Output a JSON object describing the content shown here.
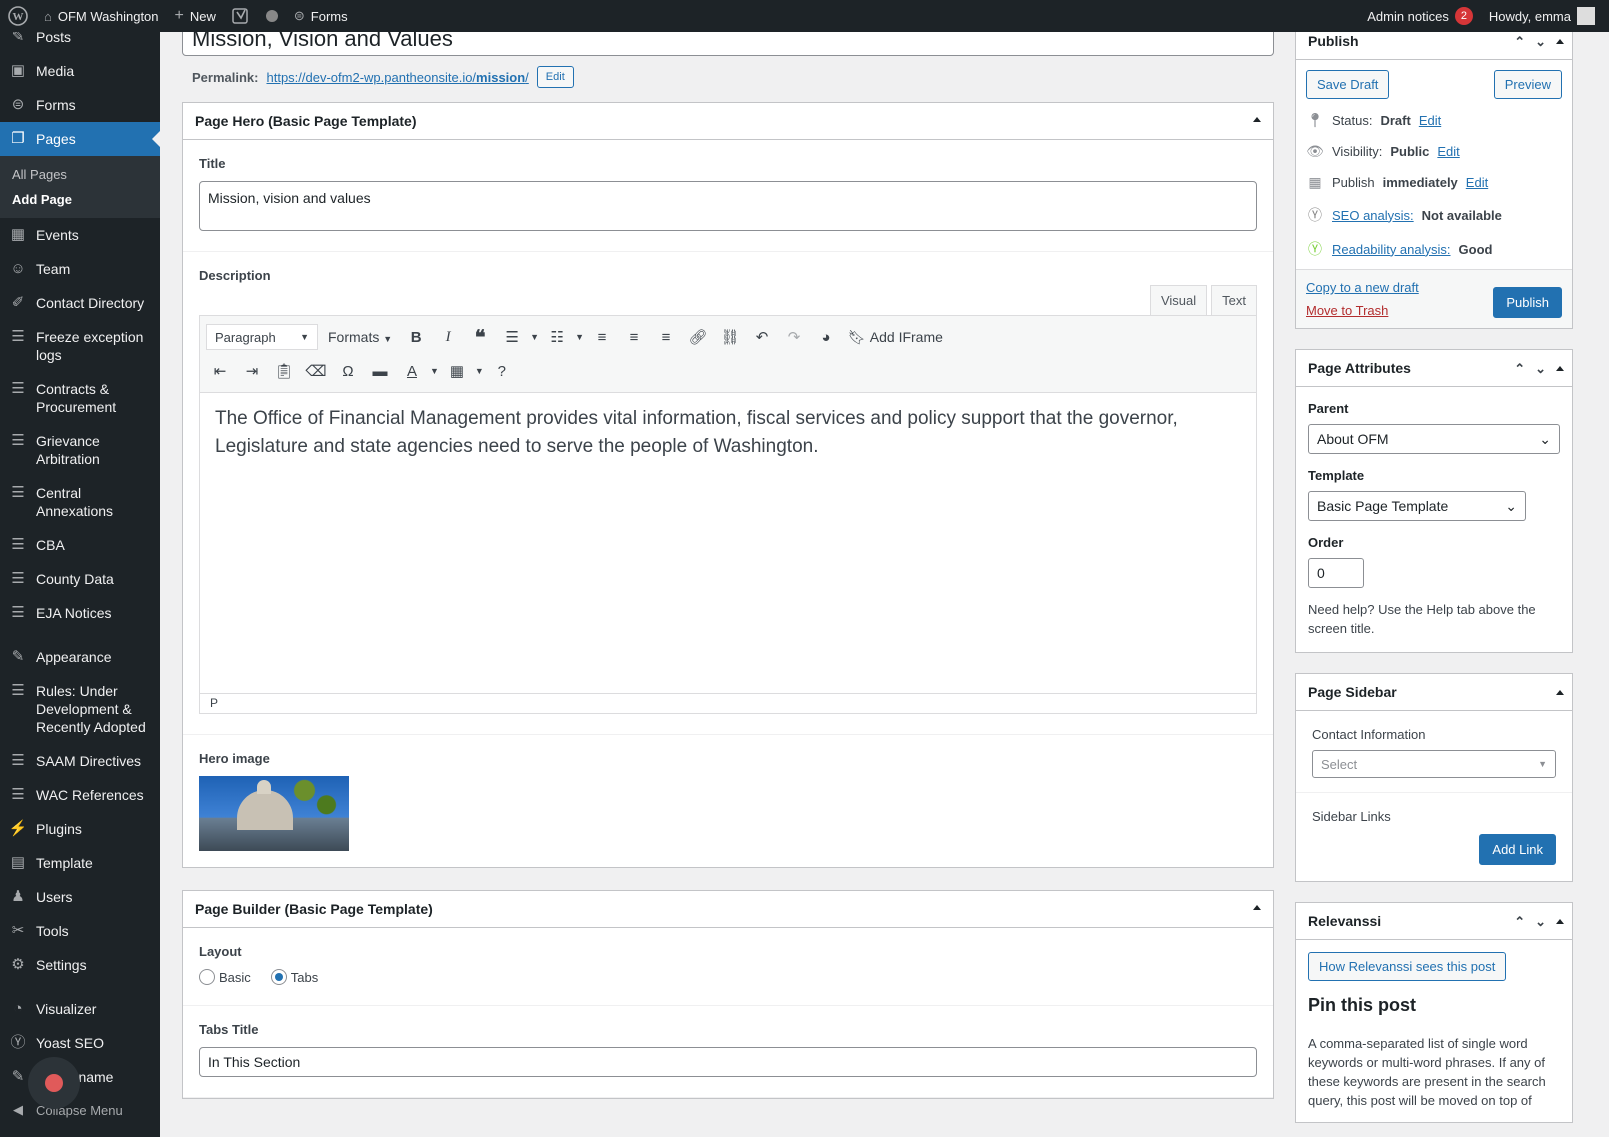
{
  "adminbar": {
    "site_name": "OFM Washington",
    "new_label": "New",
    "forms_label": "Forms",
    "admin_notices_label": "Admin notices",
    "admin_notices_count": "2",
    "howdy": "Howdy, emma"
  },
  "menu": {
    "items": [
      {
        "label": "Posts",
        "icon": "pin-icon"
      },
      {
        "label": "Media",
        "icon": "media-icon"
      },
      {
        "label": "Forms",
        "icon": "forms-icon"
      },
      {
        "label": "Pages",
        "icon": "pages-icon"
      },
      {
        "label": "Events",
        "icon": "calendar-icon"
      },
      {
        "label": "Team",
        "icon": "team-icon"
      },
      {
        "label": "Contact Directory",
        "icon": "brush-icon"
      },
      {
        "label": "Freeze exception logs",
        "icon": "database-icon"
      },
      {
        "label": "Contracts & Procurement",
        "icon": "database-icon"
      },
      {
        "label": "Grievance Arbitration",
        "icon": "database-icon"
      },
      {
        "label": "Central Annexations",
        "icon": "database-icon"
      },
      {
        "label": "CBA",
        "icon": "database-icon"
      },
      {
        "label": "County Data",
        "icon": "database-icon"
      },
      {
        "label": "EJA Notices",
        "icon": "database-icon"
      },
      {
        "label": "Appearance",
        "icon": "appearance-icon"
      },
      {
        "label": "Rules: Under Development & Recently Adopted",
        "icon": "database-icon"
      },
      {
        "label": "SAAM Directives",
        "icon": "database-icon"
      },
      {
        "label": "WAC References",
        "icon": "database-icon"
      },
      {
        "label": "Plugins",
        "icon": "plugins-icon"
      },
      {
        "label": "Template",
        "icon": "table-icon"
      },
      {
        "label": "Users",
        "icon": "users-icon"
      },
      {
        "label": "Tools",
        "icon": "tools-icon"
      },
      {
        "label": "Settings",
        "icon": "settings-icon"
      },
      {
        "label": "Visualizer",
        "icon": "visualizer-icon"
      },
      {
        "label": "Yoast SEO",
        "icon": "yoast-icon"
      },
      {
        "label": "ername",
        "icon": "edit-icon"
      }
    ],
    "submenu": [
      "All Pages",
      "Add Page"
    ],
    "collapse_label": "Collapse Menu"
  },
  "editor": {
    "post_title": "Mission, Vision and Values",
    "permalink_label": "Permalink:",
    "permalink_base": "https://dev-ofm2-wp.pantheonsite.io/",
    "permalink_slug": "mission",
    "permalink_trailing": "/",
    "permalink_edit": "Edit"
  },
  "hero": {
    "header": "Page Hero (Basic Page Template)",
    "title_label": "Title",
    "title_value": "Mission, vision and values",
    "description_label": "Description",
    "tab_visual": "Visual",
    "tab_text": "Text",
    "paragraph_select": "Paragraph",
    "formats_label": "Formats",
    "add_iframe_label": "Add IFrame",
    "content": "The Office of Financial Management provides vital information, fiscal services and policy support that the governor, Legislature and state agencies need to serve the people of Washington.",
    "status_path": "P",
    "hero_image_label": "Hero image"
  },
  "builder": {
    "header": "Page Builder (Basic Page Template)",
    "layout_label": "Layout",
    "layout_options": [
      "Basic",
      "Tabs"
    ],
    "layout_selected": "Tabs",
    "tabs_title_label": "Tabs Title",
    "tabs_title_value": "In This Section"
  },
  "publish": {
    "header": "Publish",
    "save_draft": "Save Draft",
    "preview": "Preview",
    "status_label": "Status:",
    "status_value": "Draft",
    "visibility_label": "Visibility:",
    "visibility_value": "Public",
    "publish_label": "Publish",
    "publish_value": "immediately",
    "edit": "Edit",
    "seo_label": "SEO analysis:",
    "seo_value": "Not available",
    "readability_label": "Readability analysis:",
    "readability_value": "Good",
    "copy_draft": "Copy to a new draft",
    "move_trash": "Move to Trash",
    "publish_button": "Publish"
  },
  "attributes": {
    "header": "Page Attributes",
    "parent_label": "Parent",
    "parent_value": "About OFM",
    "template_label": "Template",
    "template_value": "Basic Page Template",
    "order_label": "Order",
    "order_value": "0",
    "help_text": "Need help? Use the Help tab above the screen title."
  },
  "sidebar_box": {
    "header": "Page Sidebar",
    "contact_label": "Contact Information",
    "contact_placeholder": "Select",
    "links_label": "Sidebar Links",
    "add_link": "Add Link"
  },
  "relevanssi": {
    "header": "Relevanssi",
    "how_button": "How Relevanssi sees this post",
    "pin_title": "Pin this post",
    "pin_text": "A comma-separated list of single word keywords or multi-word phrases. If any of these keywords are present in the search query, this post will be moved on top of"
  },
  "colors": {
    "accent": "#2271b1",
    "admin_dark": "#1d2327",
    "trash": "#b32d2e",
    "notice_badge": "#d63638"
  }
}
